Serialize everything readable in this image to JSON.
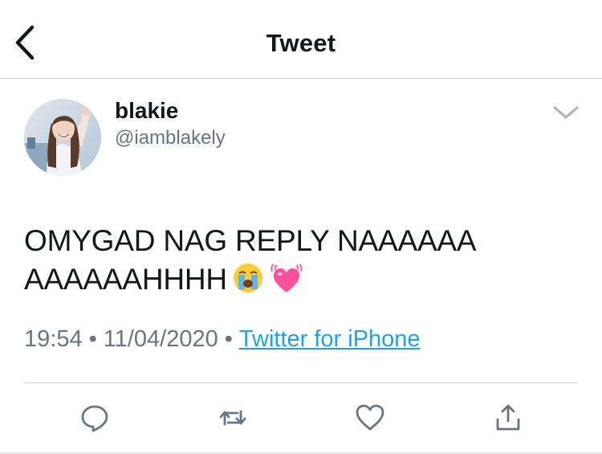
{
  "header": {
    "title": "Tweet",
    "back_icon": "chevron-left-icon"
  },
  "tweet": {
    "author": {
      "display_name": "blakie",
      "handle": "@iamblakely"
    },
    "text_line1": "OMYGAD NAG REPLY NAAAAAA",
    "text_line2": "AAAAAAHHHH",
    "emojis": [
      "loudly-crying-face-emoji",
      "beating-heart-emoji"
    ],
    "time": "19:54",
    "date": "11/04/2020",
    "separator": "•",
    "source": "Twitter for iPhone"
  },
  "actions": [
    {
      "name": "reply",
      "icon": "reply-bubble-icon"
    },
    {
      "name": "retweet",
      "icon": "retweet-icon"
    },
    {
      "name": "like",
      "icon": "heart-icon"
    },
    {
      "name": "share",
      "icon": "share-icon"
    }
  ],
  "colors": {
    "accent": "#1da1f2",
    "secondary_text": "#657786",
    "icon_gray": "#657786",
    "primary_text": "#14171a"
  }
}
